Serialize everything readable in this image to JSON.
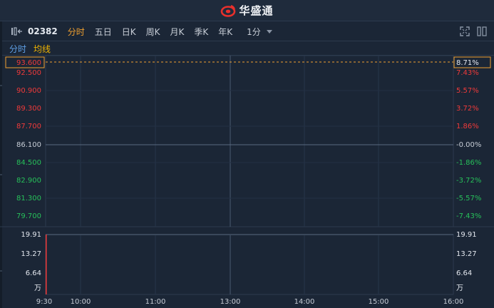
{
  "header": {
    "brand_name": "华盛通"
  },
  "toolbar": {
    "code": "02382",
    "periods": [
      "分时",
      "五日",
      "日K",
      "周K",
      "月K",
      "季K",
      "年K"
    ],
    "active_period": "分时",
    "interval": "1分"
  },
  "legend": {
    "time_label": "分时",
    "avg_label": "均线"
  },
  "colors": {
    "up": "#ef3a3a",
    "down": "#27c05a",
    "neutral": "#c7cdd6",
    "accent": "#f0a030",
    "avg": "#f0b400",
    "time": "#5fa0e6"
  },
  "chart_data": {
    "type": "line",
    "price_labels": [
      "93.600",
      "92.500",
      "90.900",
      "89.300",
      "87.700",
      "86.100",
      "84.500",
      "82.900",
      "81.300",
      "79.700"
    ],
    "pct_labels": [
      "8.71%",
      "7.43%",
      "5.57%",
      "3.72%",
      "1.86%",
      "-0.00%",
      "-1.86%",
      "-3.72%",
      "-5.57%",
      "-7.43%"
    ],
    "highlight_price": "93.600",
    "highlight_pct": "8.71%",
    "base_price": "86.100",
    "volume_labels": [
      "19.91",
      "13.27",
      "6.64",
      "万"
    ],
    "volume_labels_right": [
      "19.91",
      "13.27",
      "6.64",
      "万"
    ],
    "x_labels": [
      "9:30",
      "10:00",
      "11:00",
      "13:00",
      "14:00",
      "15:00",
      "16:00"
    ],
    "volume_bars": [
      {
        "time": "9:30",
        "value": 19.91
      }
    ]
  }
}
